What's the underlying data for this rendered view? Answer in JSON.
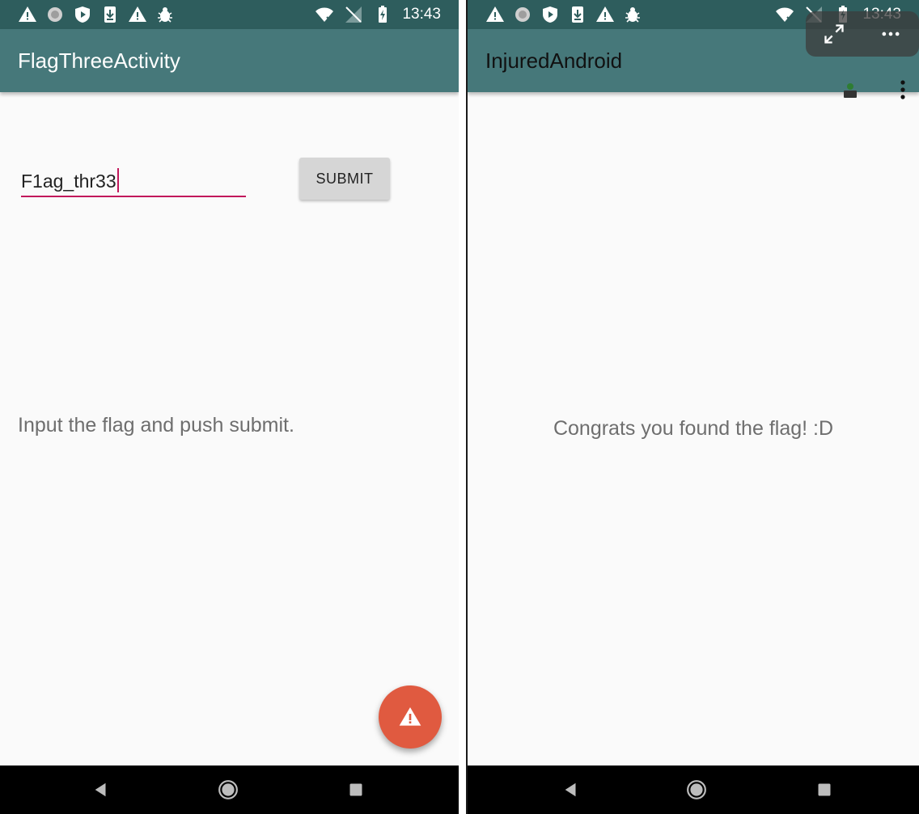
{
  "left": {
    "status": {
      "time": "13:43"
    },
    "app_title": "FlagThreeActivity",
    "flag_input": {
      "value": "F1ag_thr33"
    },
    "submit_label": "SUBMIT",
    "hint": "Input the flag and push submit.",
    "fab_icon": "warning-icon"
  },
  "right": {
    "status": {
      "time": "13:43"
    },
    "app_title": "InjuredAndroid",
    "message": "Congrats you found the flag! :D",
    "overlay_icons": [
      "fullscreen-icon",
      "more-horizontal-icon"
    ]
  },
  "nav": {
    "back": "back-icon",
    "home": "home-icon",
    "recents": "recents-icon"
  },
  "colors": {
    "status_bar": "#2e5d5d",
    "app_bar": "#46787a",
    "accent": "#c2185b",
    "fab": "#e05a40",
    "background": "#fafafa"
  }
}
